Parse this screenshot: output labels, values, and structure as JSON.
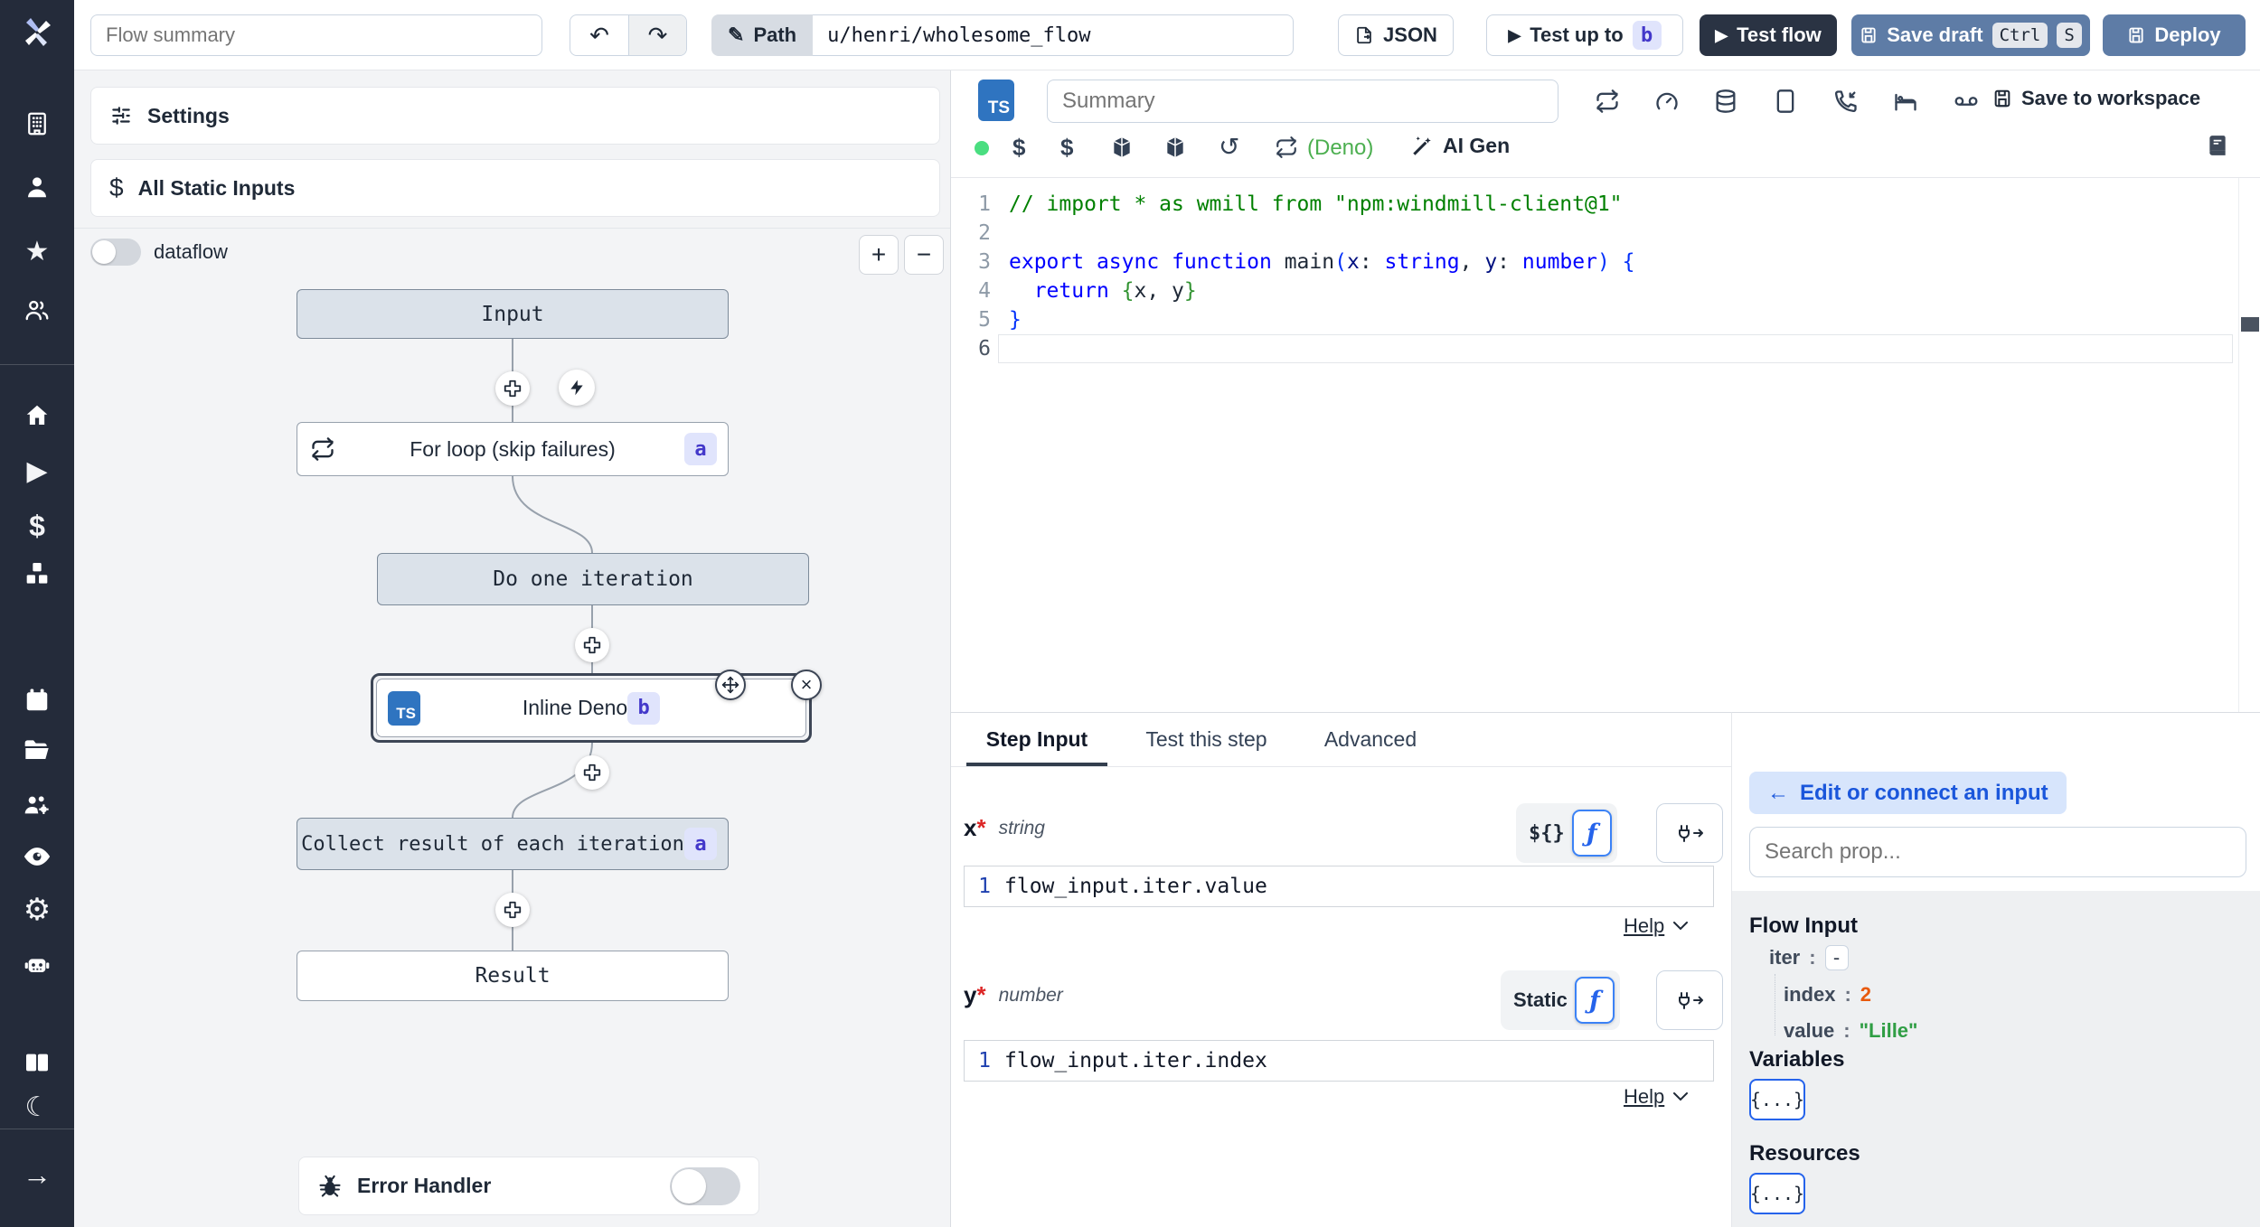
{
  "colors": {
    "sidebar_bg": "#242b3a",
    "steel_button": "#5e7ca6",
    "dark_button": "#2a3343",
    "badge_bg": "#e0e4fc",
    "badge_text": "#4338ca",
    "deno_green": "#4caf50",
    "status_dot": "#4ade80",
    "node_gray": "#dbe2ea",
    "ts_blue": "#2f74c0",
    "number_orange": "#e8590c",
    "string_green": "#2f9e44",
    "link_blue": "#1a56db"
  },
  "topbar": {
    "flow_summary_placeholder": "Flow summary",
    "path_label": "Path",
    "path_value": "u/henri/wholesome_flow",
    "json_label": "JSON",
    "test_up_to_label": "Test up to",
    "test_up_to_badge": "b",
    "test_flow_label": "Test flow",
    "save_draft_label": "Save draft",
    "save_kbd_ctrl": "Ctrl",
    "save_kbd_s": "S",
    "deploy_label": "Deploy"
  },
  "sidebar": {
    "icons": [
      "workspace-building",
      "user",
      "favorites-star",
      "groups-users",
      "home",
      "runs-play",
      "variables-dollar",
      "resources-cubes",
      "schedules-calendar",
      "folders-folder",
      "group-manage",
      "audit-eye",
      "settings-gear",
      "workers-robot",
      "docs-book",
      "dark-mode-moon",
      "collapse-arrow"
    ]
  },
  "flow_panel": {
    "settings_label": "Settings",
    "static_inputs_label": "All Static Inputs",
    "dataflow_label": "dataflow",
    "zoom_in": "+",
    "zoom_out": "−",
    "nodes": {
      "input": "Input",
      "forloop": "For loop (skip failures)",
      "forloop_badge": "a",
      "iteration": "Do one iteration",
      "inline": "Inline Deno",
      "inline_lang": "TS",
      "inline_badge": "b",
      "collect": "Collect result of each iteration",
      "collect_badge": "a",
      "result": "Result"
    },
    "error_handler_label": "Error Handler"
  },
  "editor": {
    "lang_badge": "TS",
    "summary_placeholder": "Summary",
    "language": "(Deno)",
    "ai_gen_label": "AI Gen",
    "save_workspace_label": "Save to workspace",
    "code_lines": [
      {
        "n": "1",
        "active": false,
        "tokens": [
          {
            "t": "// import * as wmill from \"npm:windmill-client@1\"",
            "c": "comment"
          }
        ]
      },
      {
        "n": "2",
        "active": false,
        "tokens": []
      },
      {
        "n": "3",
        "active": false,
        "tokens": [
          {
            "t": "export",
            "c": "kw"
          },
          {
            "t": " ",
            "c": "pl"
          },
          {
            "t": "async",
            "c": "kw"
          },
          {
            "t": " ",
            "c": "pl"
          },
          {
            "t": "function",
            "c": "kw"
          },
          {
            "t": " main",
            "c": "pl"
          },
          {
            "t": "(",
            "c": "br1"
          },
          {
            "t": "x",
            "c": "var"
          },
          {
            "t": ": ",
            "c": "pl"
          },
          {
            "t": "string",
            "c": "kw"
          },
          {
            "t": ", ",
            "c": "pl"
          },
          {
            "t": "y",
            "c": "var"
          },
          {
            "t": ": ",
            "c": "pl"
          },
          {
            "t": "number",
            "c": "kw"
          },
          {
            "t": ") ",
            "c": "br1"
          },
          {
            "t": "{",
            "c": "br1"
          }
        ]
      },
      {
        "n": "4",
        "active": false,
        "tokens": [
          {
            "t": "  ",
            "c": "pl"
          },
          {
            "t": "return",
            "c": "kw"
          },
          {
            "t": " ",
            "c": "pl"
          },
          {
            "t": "{",
            "c": "br2"
          },
          {
            "t": "x, y",
            "c": "pl"
          },
          {
            "t": "}",
            "c": "br2"
          }
        ]
      },
      {
        "n": "5",
        "active": false,
        "tokens": [
          {
            "t": "}",
            "c": "br1"
          }
        ]
      },
      {
        "n": "6",
        "active": true,
        "tokens": []
      }
    ]
  },
  "step": {
    "tabs": [
      "Step Input",
      "Test this step",
      "Advanced"
    ],
    "fields": [
      {
        "label": "x",
        "required": "*",
        "type": "string",
        "mode": "${}",
        "gutter": "1",
        "expr": "flow_input.iter.value",
        "help": "Help"
      },
      {
        "label": "y",
        "required": "*",
        "type": "number",
        "mode": "Static",
        "gutter": "1",
        "expr": "flow_input.iter.index",
        "help": "Help"
      }
    ]
  },
  "props": {
    "back_arrow": "←",
    "edit_connect_label": "Edit or connect an input",
    "search_placeholder": "Search prop...",
    "flow_input_title": "Flow Input",
    "tree": {
      "iter_key": "iter",
      "iter_value": "-",
      "index_key": "index",
      "index_value": "2",
      "value_key": "value",
      "value_value": "\"Lille\""
    },
    "variables_title": "Variables",
    "resources_title": "Resources",
    "object_chip": "{...}"
  }
}
